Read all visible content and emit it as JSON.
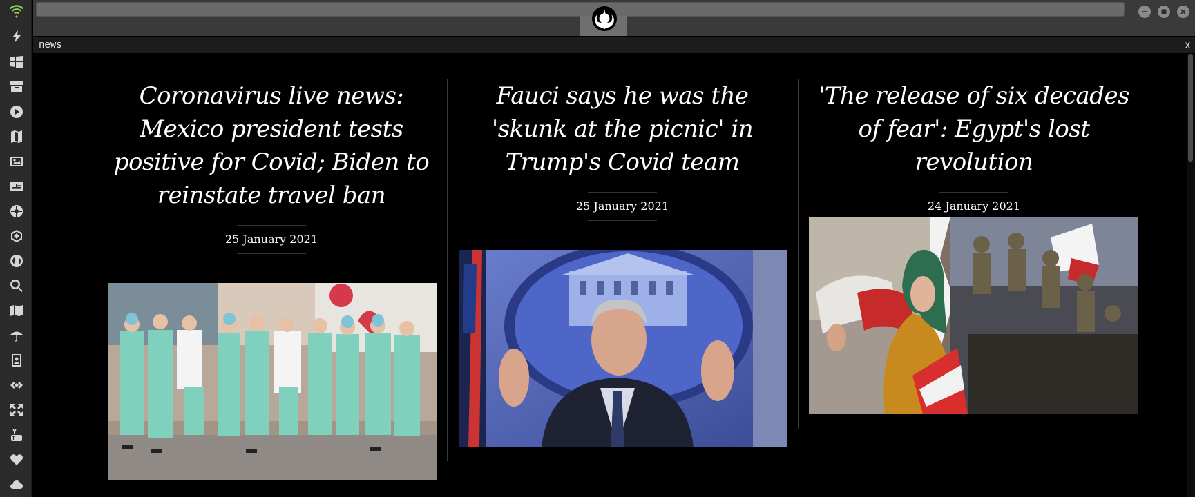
{
  "tab": {
    "label": "news",
    "close": "x"
  },
  "sidebar": {
    "icons": [
      "wifi-icon",
      "lightning-icon",
      "windows-icon",
      "archive-icon",
      "play-icon",
      "map-book-icon",
      "image-icon",
      "newspaper-icon",
      "empire-icon",
      "hexagon-icon",
      "globe-icon",
      "search-icon",
      "map-icon",
      "umbrella-icon",
      "contacts-icon",
      "link-icon",
      "expand-icon",
      "youtube-icon",
      "heart-icon",
      "cloud-icon"
    ],
    "wifi_color": "#8fd14f"
  },
  "articles": [
    {
      "headline": "Coronavirus live news: Mexico president tests positive for Covid; Biden to reinstate travel ban",
      "date": "25 January 2021",
      "image": "nurses-in-queue-photo"
    },
    {
      "headline": "Fauci says he was the 'skunk at the picnic' in Trump's Covid team",
      "date": "25 January 2021",
      "image": "fauci-white-house-photo"
    },
    {
      "headline": "'The release of six decades of fear': Egypt's lost revolution",
      "date": "24 January 2021",
      "image": "egypt-revolution-photo"
    }
  ]
}
